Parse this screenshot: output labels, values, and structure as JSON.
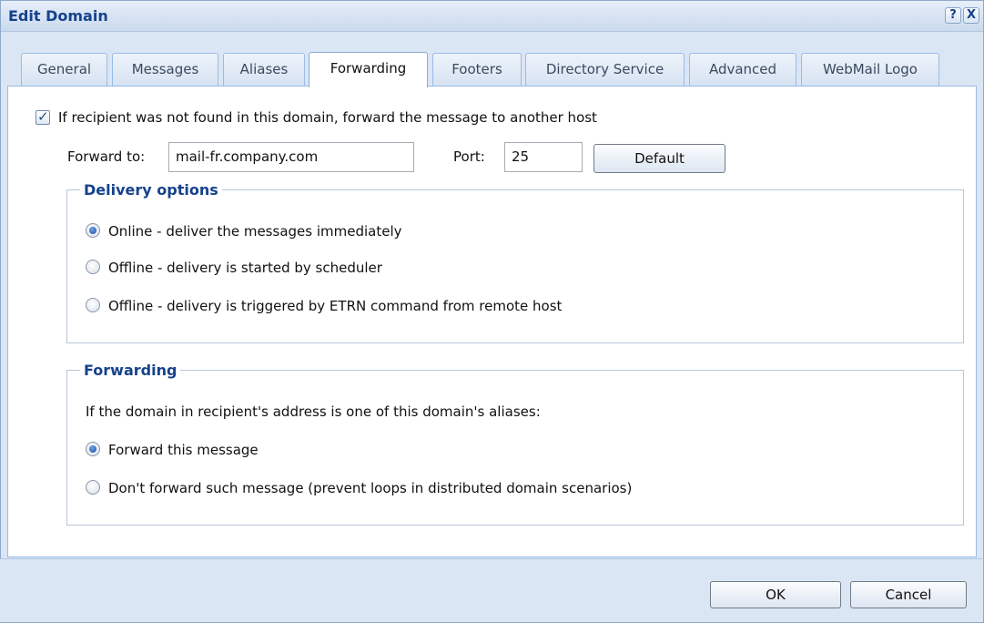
{
  "window": {
    "title": "Edit Domain",
    "help_label": "?",
    "close_label": "X"
  },
  "tabs": [
    {
      "label": "General",
      "active": false
    },
    {
      "label": "Messages",
      "active": false
    },
    {
      "label": "Aliases",
      "active": false
    },
    {
      "label": "Forwarding",
      "active": true
    },
    {
      "label": "Footers",
      "active": false
    },
    {
      "label": "Directory Service",
      "active": false
    },
    {
      "label": "Advanced",
      "active": false
    },
    {
      "label": "WebMail Logo",
      "active": false
    }
  ],
  "forward": {
    "enable_label": "If recipient was not found in this domain, forward the message to another host",
    "enable_checked": true,
    "forward_to_label": "Forward to:",
    "forward_to_value": "mail-fr.company.com",
    "port_label": "Port:",
    "port_value": "25",
    "default_button": "Default"
  },
  "delivery": {
    "legend": "Delivery options",
    "options": [
      {
        "label": "Online - deliver the messages immediately",
        "selected": true
      },
      {
        "label": "Offline - delivery is started by scheduler",
        "selected": false
      },
      {
        "label": "Offline - delivery is triggered by ETRN command from remote host",
        "selected": false
      }
    ]
  },
  "forwarding": {
    "legend": "Forwarding",
    "description": "If the domain in recipient's address is one of this domain's aliases:",
    "options": [
      {
        "label": "Forward this message",
        "selected": true
      },
      {
        "label": "Don't forward such message (prevent loops in distributed domain scenarios)",
        "selected": false
      }
    ]
  },
  "footer": {
    "ok_label": "OK",
    "cancel_label": "Cancel"
  }
}
